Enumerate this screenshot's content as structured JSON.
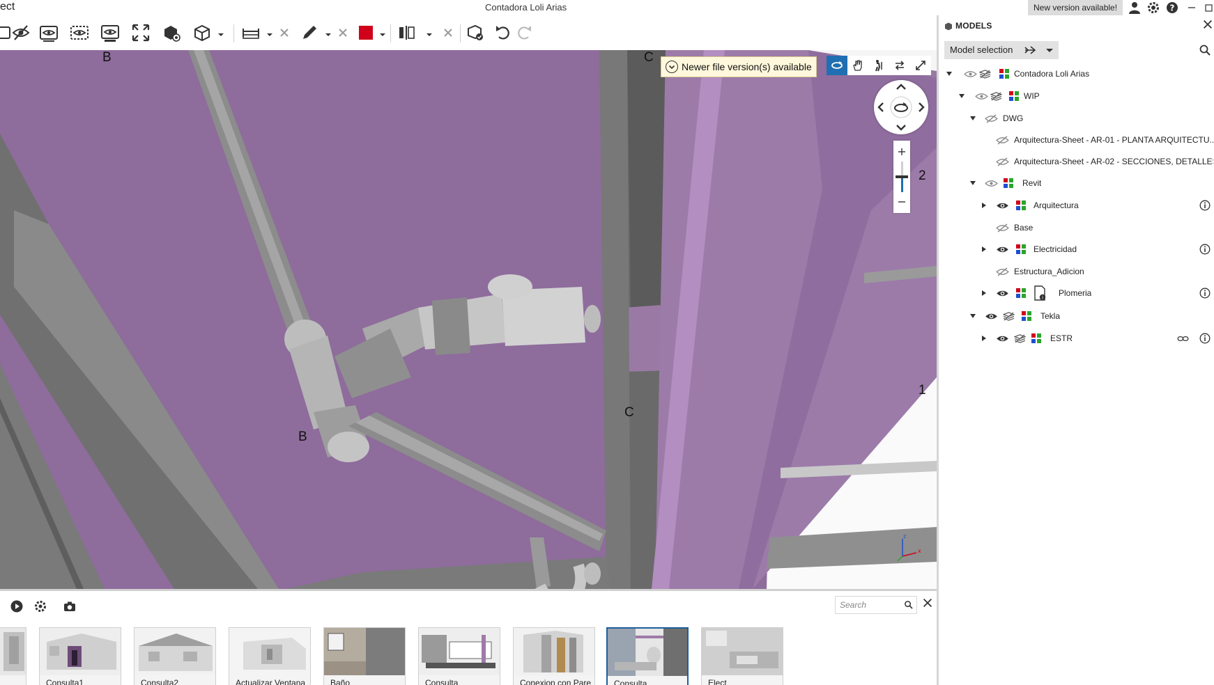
{
  "app": {
    "title": "ect",
    "document_title": "Contadora Loli Arias",
    "new_version_label": "New version available!"
  },
  "viewport": {
    "notice": "Newer file version(s) available",
    "labels": {
      "b_top": "B",
      "b_mid": "B",
      "c_top": "C",
      "c_mid": "C",
      "grid_2": "2",
      "grid_1": "1"
    }
  },
  "bottom": {
    "search_placeholder": "Search",
    "views": [
      {
        "label": ""
      },
      {
        "label": "Consulta1"
      },
      {
        "label": "Consulta2"
      },
      {
        "label": "Actualizar Ventana"
      },
      {
        "label": "Baño"
      },
      {
        "label": "Consulta"
      },
      {
        "label": "Conexion con Pare"
      },
      {
        "label": "Consulta"
      },
      {
        "label": "Elect"
      }
    ]
  },
  "panel": {
    "title": "MODELS",
    "model_selection_label": "Model selection",
    "tree": [
      {
        "label": "Contadora Loli Arias"
      },
      {
        "label": "WIP"
      },
      {
        "label": "DWG"
      },
      {
        "label": "Arquitectura-Sheet - AR-01 - PLANTA ARQUITECTU..."
      },
      {
        "label": "Arquitectura-Sheet - AR-02 - SECCIONES, DETALLES..."
      },
      {
        "label": "Revit"
      },
      {
        "label": "Arquitectura"
      },
      {
        "label": "Base"
      },
      {
        "label": "Electricidad"
      },
      {
        "label": "Estructura_Adicion"
      },
      {
        "label": "Plomeria"
      },
      {
        "label": "Tekla"
      },
      {
        "label": "ESTR"
      }
    ]
  },
  "colors": {
    "wall": "#8e6c9c",
    "accent": "#1f6fb2",
    "color_swatch": "#d0021b"
  }
}
